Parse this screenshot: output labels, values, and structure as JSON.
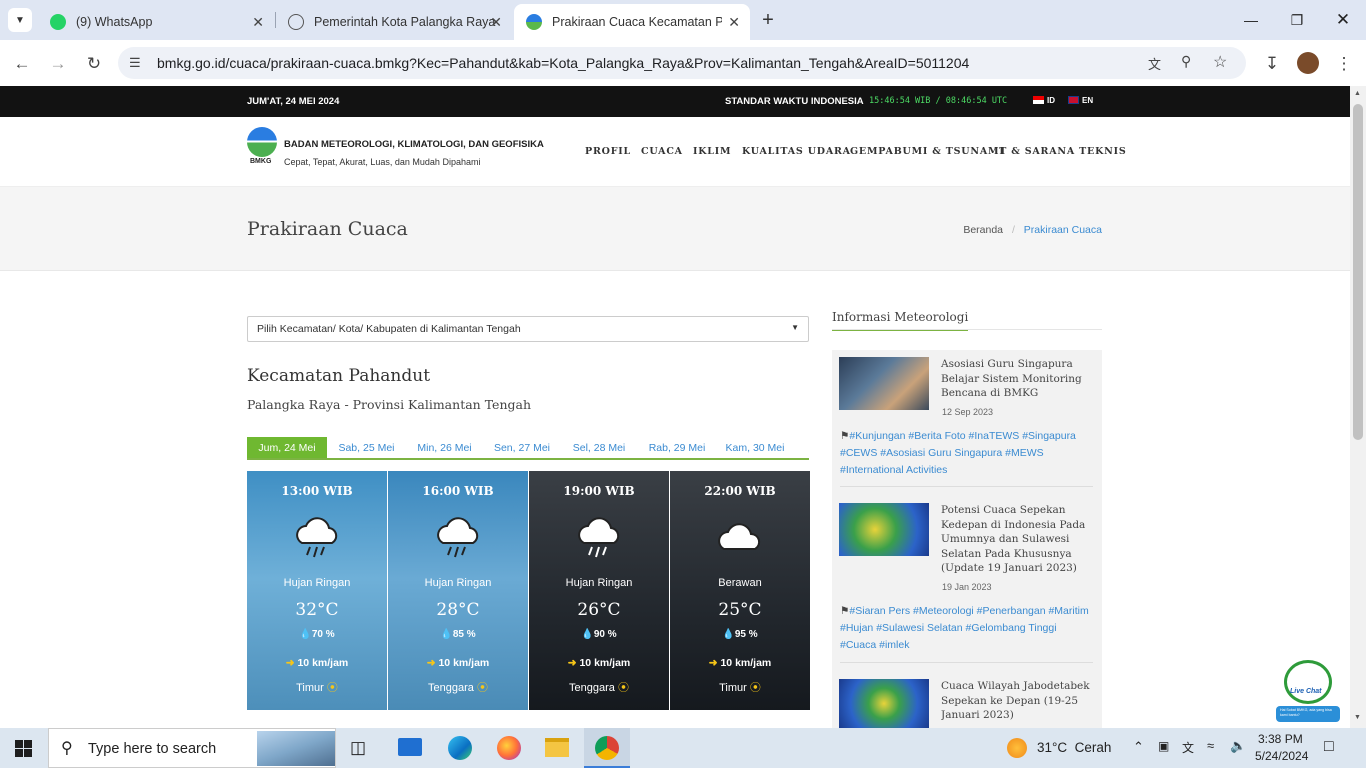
{
  "browser": {
    "tabs": [
      {
        "label": "(9) WhatsApp"
      },
      {
        "label": "Pemerintah Kota Palangka Raya"
      },
      {
        "label": "Prakiraan Cuaca Kecamatan Pah"
      }
    ],
    "url": "bmkg.go.id/cuaca/prakiraan-cuaca.bmkg?Kec=Pahandut&kab=Kota_Palangka_Raya&Prov=Kalimantan_Tengah&AreaID=5011204"
  },
  "topbar": {
    "date": "JUM'AT, 24 MEI 2024",
    "std_label": "STANDAR WAKTU INDONESIA",
    "clock": "15:46:54 WIB / 08:46:54 UTC",
    "lang_id": "ID",
    "lang_en": "EN"
  },
  "header": {
    "logo_text": "BMKG",
    "org_name": "BADAN METEOROLOGI, KLIMATOLOGI, DAN GEOFISIKA",
    "tagline": "Cepat, Tepat, Akurat, Luas, dan Mudah Dipahami",
    "menu": [
      "PROFIL",
      "CUACA",
      "IKLIM",
      "KUALITAS UDARA",
      "GEMPABUMI & TSUNAMI",
      "IT & SARANA TEKNIS"
    ]
  },
  "page": {
    "title": "Prakiraan Cuaca",
    "breadcrumb_home": "Beranda",
    "breadcrumb_sep": "/",
    "breadcrumb_current": "Prakiraan Cuaca"
  },
  "forecast": {
    "select_label": "Pilih Kecamatan/ Kota/ Kabupaten di Kalimantan Tengah",
    "location": "Kecamatan Pahandut",
    "region": "Palangka Raya - Provinsi Kalimantan Tengah",
    "days": [
      "Jum, 24 Mei",
      "Sab, 25 Mei",
      "Min, 26 Mei",
      "Sen, 27 Mei",
      "Sel, 28 Mei",
      "Rab, 29 Mei",
      "Kam, 30 Mei"
    ],
    "cards": [
      {
        "time": "13:00 WIB",
        "condition": "Hujan Ringan",
        "temp": "32°C",
        "humidity": "70 %",
        "wind": "10 km/jam",
        "direction": "Timur"
      },
      {
        "time": "16:00 WIB",
        "condition": "Hujan Ringan",
        "temp": "28°C",
        "humidity": "85 %",
        "wind": "10 km/jam",
        "direction": "Tenggara"
      },
      {
        "time": "19:00 WIB",
        "condition": "Hujan Ringan",
        "temp": "26°C",
        "humidity": "90 %",
        "wind": "10 km/jam",
        "direction": "Tenggara"
      },
      {
        "time": "22:00 WIB",
        "condition": "Berawan",
        "temp": "25°C",
        "humidity": "95 %",
        "wind": "10 km/jam",
        "direction": "Timur"
      }
    ]
  },
  "sidebar": {
    "heading": "Informasi Meteorologi",
    "news": [
      {
        "title": "Asosiasi Guru Singapura Belajar Sistem Monitoring Bencana di BMKG",
        "date": "12 Sep 2023",
        "tags": "#Kunjungan #Berita Foto #InaTEWS #Singapura #CEWS #Asosiasi Guru Singapura #MEWS #International Activities"
      },
      {
        "title": "Potensi Cuaca Sepekan Kedepan di Indonesia Pada Umumnya dan Sulawesi Selatan Pada Khususnya (Update 19 Januari 2023)",
        "date": "19 Jan 2023",
        "tags": "#Siaran Pers #Meteorologi #Penerbangan #Maritim #Hujan #Sulawesi Selatan #Gelombang Tinggi #Cuaca #imlek"
      },
      {
        "title": "Cuaca Wilayah Jabodetabek Sepekan ke Depan (19-25 Januari 2023)"
      }
    ],
    "livechat": "Live Chat",
    "livechat_sub": "Hai Sobat BMKG, ada yang bisa kami bantu?"
  },
  "taskbar": {
    "search_placeholder": "Type here to search",
    "weather": "31°C  Cerah",
    "time": "3:38 PM",
    "date": "5/24/2024"
  }
}
